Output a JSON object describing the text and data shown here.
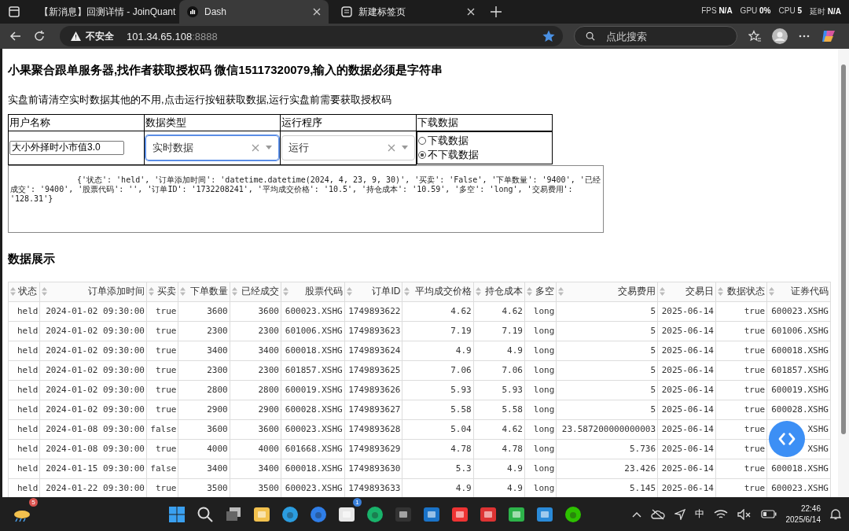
{
  "browser": {
    "tabs": [
      {
        "title": "【新消息】回测详情 - JoinQuant",
        "selected": false
      },
      {
        "title": "Dash",
        "selected": true
      },
      {
        "title": "新建标签页",
        "selected": false
      }
    ],
    "perf": [
      {
        "label": "FPS",
        "value": "N/A"
      },
      {
        "label": "GPU",
        "value": "0%"
      },
      {
        "label": "CPU",
        "value": "5"
      },
      {
        "label": "延时",
        "value": "N/A"
      }
    ],
    "security": "不安全",
    "url_host": "101.34.65.108",
    "url_port": ":8888",
    "search": {
      "placeholder": "点此搜索"
    }
  },
  "page": {
    "title": "小果聚合跟单服务器,找作者获取授权码 微信15117320079,输入的数据必须是字符串",
    "note": "实盘前请清空实时数据其他的不用,点击运行按钮获取数据,运行实盘前需要获取授权码",
    "form": {
      "columns": [
        "用户名称",
        "数据类型",
        "运行程序",
        "下载数据"
      ],
      "user_name": "大小外择时小市值3.0",
      "data_type": {
        "value": "实时数据",
        "focused": true
      },
      "program": {
        "value": "运行",
        "focused": false
      },
      "download_options": [
        {
          "label": "下载数据",
          "selected": false
        },
        {
          "label": "不下载数据",
          "selected": true
        }
      ],
      "output": "{'状态': 'held', '订单添加时间': 'datetime.datetime(2024, 4, 23, 9, 30)', '买卖': 'False', '下单数量': '9400', '已经成交': '9400', '股票代码': '', '订单ID': '1732208241', '平均成交价格': '10.5', '持仓成本': '10.59', '多空': 'long', '交易费用': '128.31'}"
    },
    "section_title": "数据展示",
    "table": {
      "columns": [
        "状态",
        "订单添加时间",
        "买卖",
        "下单数量",
        "已经成交",
        "股票代码",
        "订单ID",
        "平均成交价格",
        "持仓成本",
        "多空",
        "交易费用",
        "交易日",
        "数据状态",
        "证券代码"
      ],
      "rows": [
        [
          "held",
          "2024-01-02 09:30:00",
          "true",
          "3600",
          "3600",
          "600023.XSHG",
          "1749893622",
          "4.62",
          "4.62",
          "long",
          "5",
          "2025-06-14",
          "true",
          "600023.XSHG"
        ],
        [
          "held",
          "2024-01-02 09:30:00",
          "true",
          "2300",
          "2300",
          "601006.XSHG",
          "1749893623",
          "7.19",
          "7.19",
          "long",
          "5",
          "2025-06-14",
          "true",
          "601006.XSHG"
        ],
        [
          "held",
          "2024-01-02 09:30:00",
          "true",
          "3400",
          "3400",
          "600018.XSHG",
          "1749893624",
          "4.9",
          "4.9",
          "long",
          "5",
          "2025-06-14",
          "true",
          "600018.XSHG"
        ],
        [
          "held",
          "2024-01-02 09:30:00",
          "true",
          "2300",
          "2300",
          "601857.XSHG",
          "1749893625",
          "7.06",
          "7.06",
          "long",
          "5",
          "2025-06-14",
          "true",
          "601857.XSHG"
        ],
        [
          "held",
          "2024-01-02 09:30:00",
          "true",
          "2800",
          "2800",
          "600019.XSHG",
          "1749893626",
          "5.93",
          "5.93",
          "long",
          "5",
          "2025-06-14",
          "true",
          "600019.XSHG"
        ],
        [
          "held",
          "2024-01-02 09:30:00",
          "true",
          "2900",
          "2900",
          "600028.XSHG",
          "1749893627",
          "5.58",
          "5.58",
          "long",
          "5",
          "2025-06-14",
          "true",
          "600028.XSHG"
        ],
        [
          "held",
          "2024-01-08 09:30:00",
          "false",
          "3600",
          "3600",
          "600023.XSHG",
          "1749893628",
          "5.04",
          "4.62",
          "long",
          "23.587200000000003",
          "2025-06-14",
          "true",
          "XSHG"
        ],
        [
          "held",
          "2024-01-08 09:30:00",
          "true",
          "4000",
          "4000",
          "601668.XSHG",
          "1749893629",
          "4.78",
          "4.78",
          "long",
          "5.736",
          "2025-06-14",
          "true",
          "XSHG"
        ],
        [
          "held",
          "2024-01-15 09:30:00",
          "false",
          "3400",
          "3400",
          "600018.XSHG",
          "1749893630",
          "5.3",
          "4.9",
          "long",
          "23.426",
          "2025-06-14",
          "true",
          "600018.XSHG"
        ],
        [
          "held",
          "2024-01-22 09:30:00",
          "true",
          "3500",
          "3500",
          "600023.XSHG",
          "1749893633",
          "4.9",
          "4.9",
          "long",
          "5.145",
          "2025-06-14",
          "true",
          "600023.XSHG"
        ]
      ]
    }
  },
  "taskbar": {
    "weather_badge": "5",
    "apps": [
      {
        "kind": "start"
      },
      {
        "kind": "search"
      },
      {
        "kind": "taskview"
      },
      {
        "kind": "folder"
      },
      {
        "kind": "edge"
      },
      {
        "kind": "edgeai"
      },
      {
        "kind": "store",
        "badge": "1"
      },
      {
        "kind": "bag"
      },
      {
        "kind": "cube"
      },
      {
        "kind": "mail"
      },
      {
        "kind": "wps"
      },
      {
        "kind": "redapp"
      },
      {
        "kind": "screen"
      },
      {
        "kind": "code"
      },
      {
        "kind": "chat"
      }
    ],
    "ime": "中",
    "time": "22:46",
    "date": "2025/6/14"
  }
}
